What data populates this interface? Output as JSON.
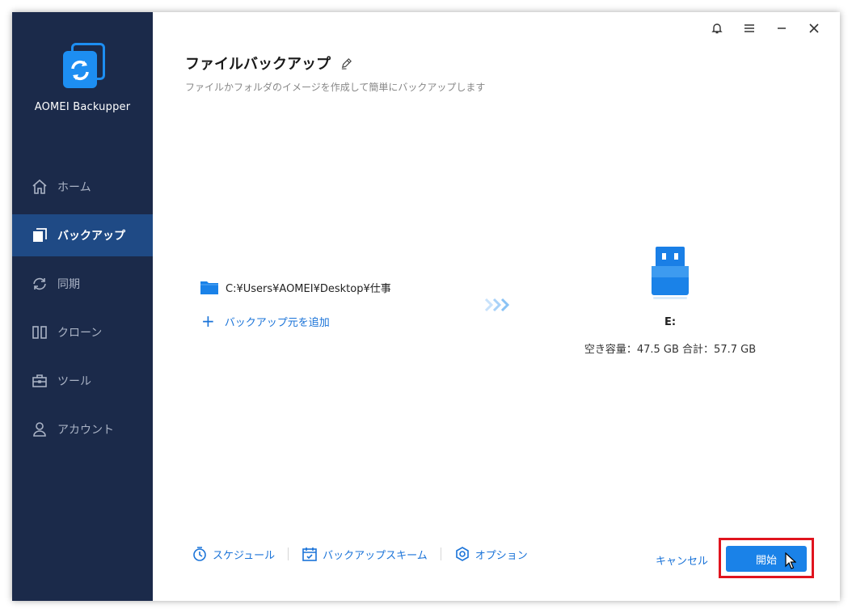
{
  "app": {
    "name": "AOMEI Backupper"
  },
  "sidebar": {
    "items": [
      {
        "label": "ホーム",
        "icon": "home-icon",
        "active": false
      },
      {
        "label": "バックアップ",
        "icon": "backup-icon",
        "active": true
      },
      {
        "label": "同期",
        "icon": "sync-icon",
        "active": false
      },
      {
        "label": "クローン",
        "icon": "clone-icon",
        "active": false
      },
      {
        "label": "ツール",
        "icon": "toolbox-icon",
        "active": false
      },
      {
        "label": "アカウント",
        "icon": "user-icon",
        "active": false
      }
    ]
  },
  "titlebar": {
    "icons": [
      "bell-icon",
      "menu-icon",
      "minimize-icon",
      "close-icon"
    ]
  },
  "main": {
    "title": "ファイルバックアップ",
    "subtitle": "ファイルかフォルダのイメージを作成して簡単にバックアップします",
    "source": {
      "path": "C:¥Users¥AOMEI¥Desktop¥仕事",
      "add_label": "バックアップ元を追加"
    },
    "destination": {
      "label": "E:",
      "capacity": "空き容量：47.5 GB 合計：57.7 GB"
    }
  },
  "bottom": {
    "schedule": "スケジュール",
    "scheme": "バックアップスキーム",
    "options": "オプション",
    "cancel": "キャンセル",
    "start": "開始"
  },
  "colors": {
    "sidebar_bg": "#1b2a4a",
    "sidebar_active": "#1f4a85",
    "accent": "#1a73d8",
    "start_btn": "#1a82e8",
    "highlight": "#e0141e"
  }
}
